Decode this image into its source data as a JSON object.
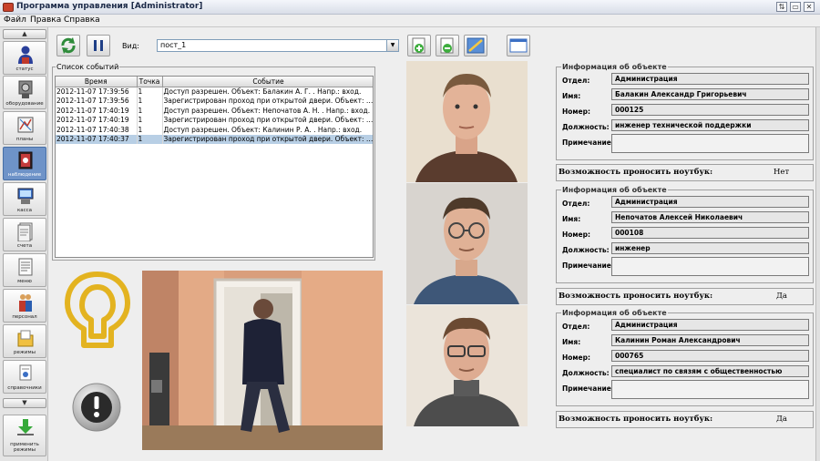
{
  "window": {
    "title": "Программа управления [Administrator]",
    "controls": [
      "⇅",
      "▭",
      "✕"
    ]
  },
  "menu": [
    "Файл",
    "Правка",
    "Справка"
  ],
  "sidebar": {
    "scroll_up": "▲",
    "scroll_down": "▼",
    "items": [
      {
        "label": "статус",
        "icon": "user-status-icon"
      },
      {
        "label": "оборудование",
        "icon": "equipment-icon"
      },
      {
        "label": "планы",
        "icon": "plans-icon"
      },
      {
        "label": "наблюдение",
        "icon": "surveillance-icon",
        "active": true
      },
      {
        "label": "касса",
        "icon": "cashbox-icon"
      },
      {
        "label": "счета",
        "icon": "bills-icon"
      },
      {
        "label": "меню",
        "icon": "menu-icon"
      },
      {
        "label": "персонал",
        "icon": "staff-icon"
      },
      {
        "label": "режимы",
        "icon": "modes-icon"
      },
      {
        "label": "справочники",
        "icon": "directories-icon"
      }
    ],
    "apply": {
      "label_line1": "применить",
      "label_line2": "режимы",
      "icon": "apply-download-icon"
    }
  },
  "toolbar": {
    "refresh_icon": "refresh-icon",
    "pause_icon": "pause-icon",
    "view_label": "Вид:",
    "view_value": "пост_1",
    "right_tools": [
      "add-view-icon",
      "remove-view-icon",
      "edit-view-icon",
      "window-view-icon"
    ]
  },
  "events": {
    "title": "Список событий",
    "columns": [
      "Время",
      "Точка",
      "Событие"
    ],
    "rows": [
      {
        "time": "2012-11-07 17:39:56",
        "point": "1",
        "event": "Доступ разрешен. Объект: Балакин А. Г. . Напр.: вход.",
        "selected": false
      },
      {
        "time": "2012-11-07 17:39:56",
        "point": "1",
        "event": "Зарегистрирован проход при открытой двери. Объект: Балакин А.",
        "selected": false
      },
      {
        "time": "2012-11-07 17:40:19",
        "point": "1",
        "event": "Доступ разрешен. Объект: Непочатов А. Н. . Напр.: вход.",
        "selected": false
      },
      {
        "time": "2012-11-07 17:40:19",
        "point": "1",
        "event": "Зарегистрирован проход при открытой двери. Объект: Непочатов",
        "selected": false
      },
      {
        "time": "2012-11-07 17:40:38",
        "point": "1",
        "event": "Доступ разрешен. Объект: Калинин Р. А. . Напр.: вход.",
        "selected": false
      },
      {
        "time": "2012-11-07 17:40:37",
        "point": "1",
        "event": "Зарегистрирован проход при открытой двери. Объект: Калинин Р.",
        "selected": true
      }
    ]
  },
  "objects": [
    {
      "info_title": "Информация об объекте",
      "dept_label": "Отдел:",
      "dept": "Администрация",
      "name_label": "Имя:",
      "name": "Балакин Александр Григорьевич",
      "number_label": "Номер:",
      "number": "000125",
      "position_label": "Должность:",
      "position": "инженер технической поддержки",
      "note_label": "Примечание:",
      "laptop_label": "Возможность проносить ноутбук:",
      "laptop": "Нет"
    },
    {
      "info_title": "Информация об объекте",
      "dept_label": "Отдел:",
      "dept": "Администрация",
      "name_label": "Имя:",
      "name": "Непочатов Алексей Николаевич",
      "number_label": "Номер:",
      "number": "000108",
      "position_label": "Должность:",
      "position": "инженер",
      "note_label": "Примечание:",
      "laptop_label": "Возможность проносить ноутбук:",
      "laptop": "Да"
    },
    {
      "info_title": "Информация об объекте",
      "dept_label": "Отдел:",
      "dept": "Администрация",
      "name_label": "Имя:",
      "name": "Калинин Роман Александрович",
      "number_label": "Номер:",
      "number": "000765",
      "position_label": "Должность:",
      "position": "специалист по связям с общественностью",
      "note_label": "Примечание:",
      "laptop_label": "Возможность проносить ноутбук:",
      "laptop": "Да"
    }
  ],
  "colors": {
    "selection": "#b8cfe5",
    "sidebar_active": "#6e93c8",
    "logo_gold": "#e3b320"
  }
}
